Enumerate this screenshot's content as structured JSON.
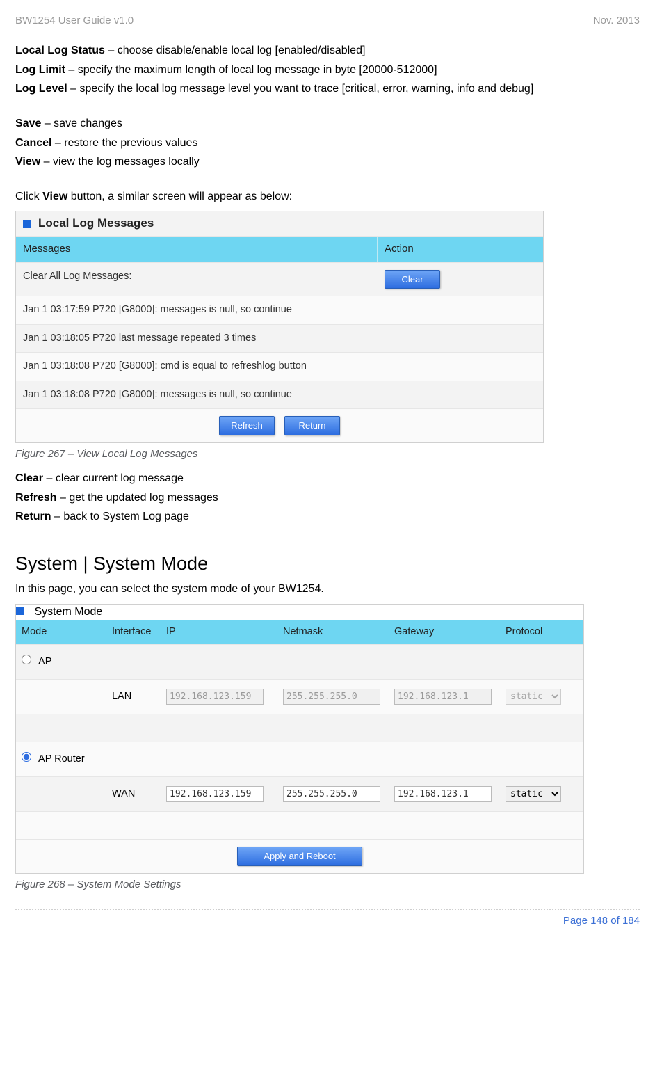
{
  "header": {
    "left": "BW1254 User Guide v1.0",
    "right": "Nov.  2013"
  },
  "defs": {
    "local_log_status": {
      "term": "Local Log Status",
      "text": " – choose disable/enable local log [enabled/disabled]"
    },
    "log_limit": {
      "term": "Log Limit",
      "text": " – specify the maximum length of local log message in byte [20000-512000]"
    },
    "log_level": {
      "term": "Log Level",
      "text": " – specify the local log message level you want to trace [critical, error, warning, info and debug]"
    },
    "save": {
      "term": "Save",
      "text": " – save changes"
    },
    "cancel": {
      "term": "Cancel",
      "text": " – restore the previous values"
    },
    "view": {
      "term": "View",
      "text": " – view the log messages locally"
    },
    "click_view_pre": "Click ",
    "click_view_bold": "View",
    "click_view_post": " button, a similar screen will appear as below:",
    "clear": {
      "term": "Clear",
      "text": " – clear current log message"
    },
    "refresh": {
      "term": "Refresh",
      "text": " – get the updated log messages"
    },
    "returnp": {
      "term": "Return",
      "text": " – back to System Log page"
    }
  },
  "fig1": {
    "title": "Local Log Messages",
    "headers": {
      "messages": "Messages",
      "action": "Action"
    },
    "clear_row_label": "Clear All Log Messages:",
    "clear_btn": "Clear",
    "rows": [
      "Jan 1 03:17:59 P720 [G8000]: messages is null, so continue",
      "Jan 1 03:18:05 P720 last message repeated 3 times",
      "Jan 1 03:18:08 P720 [G8000]: cmd is equal to refreshlog button",
      "Jan 1 03:18:08 P720 [G8000]: messages is null, so continue"
    ],
    "refresh_btn": "Refresh",
    "return_btn": "Return",
    "caption": "Figure 267 – View Local Log Messages"
  },
  "section": {
    "heading": "System | System Mode",
    "intro": "In this page, you can select the system mode of your BW1254."
  },
  "fig2": {
    "title": "System Mode",
    "headers": {
      "mode": "Mode",
      "iface": "Interface",
      "ip": "IP",
      "netmask": "Netmask",
      "gateway": "Gateway",
      "protocol": "Protocol"
    },
    "ap": {
      "label": "AP",
      "checked": false
    },
    "lan": {
      "iface": "LAN",
      "ip": "192.168.123.159",
      "netmask": "255.255.255.0",
      "gateway": "192.168.123.1",
      "protocol": "static"
    },
    "aprouter": {
      "label": "AP Router",
      "checked": true
    },
    "wan": {
      "iface": "WAN",
      "ip": "192.168.123.159",
      "netmask": "255.255.255.0",
      "gateway": "192.168.123.1",
      "protocol": "static"
    },
    "apply_btn": "Apply and Reboot",
    "caption": "Figure 268 – System Mode Settings"
  },
  "footer": {
    "page": "Page 148 of 184"
  }
}
